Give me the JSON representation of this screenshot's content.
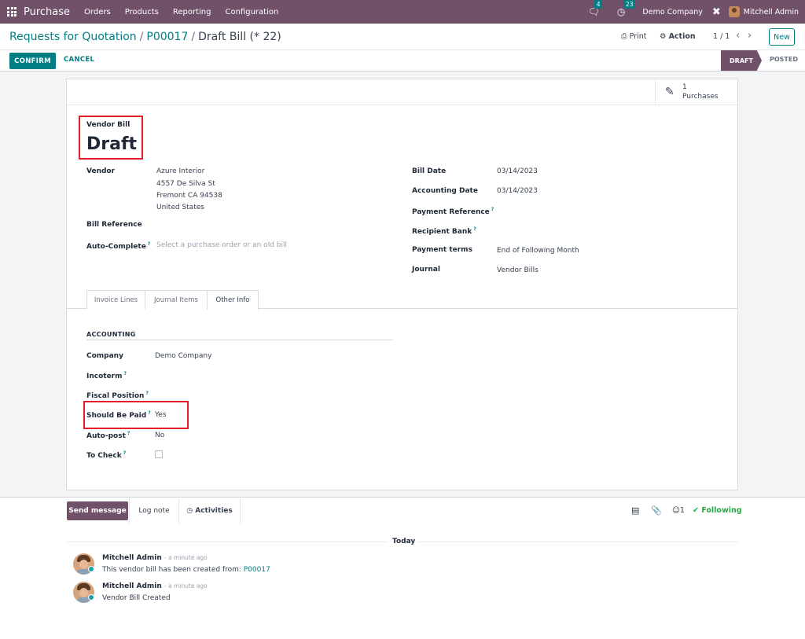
{
  "navbar": {
    "app_name": "Purchase",
    "menus": [
      "Orders",
      "Products",
      "Reporting",
      "Configuration"
    ],
    "messages_count": "4",
    "activities_count": "23",
    "company": "Demo Company",
    "user": "Mitchell Admin"
  },
  "control": {
    "breadcrumb": [
      "Requests for Quotation",
      "P00017",
      "Draft Bill (* 22)"
    ],
    "print_label": "Print",
    "action_label": "Action",
    "pager": "1 / 1",
    "new_label": "New"
  },
  "statusbar": {
    "confirm_label": "CONFIRM",
    "cancel_label": "CANCEL",
    "stages": [
      "DRAFT",
      "POSTED"
    ],
    "active_stage": "DRAFT"
  },
  "smart_button": {
    "count": "1",
    "label": "Purchases"
  },
  "form": {
    "type_label": "Vendor Bill",
    "title": "Draft",
    "left_fields": {
      "vendor_label": "Vendor",
      "vendor_lines": [
        "Azure Interior",
        "4557 De Silva St",
        "Fremont CA 94538",
        "United States"
      ],
      "bill_reference_label": "Bill Reference",
      "auto_complete_label": "Auto-Complete",
      "auto_complete_placeholder": "Select a purchase order or an old bill"
    },
    "right_fields": [
      {
        "label": "Bill Date",
        "value": "03/14/2023",
        "help": false
      },
      {
        "label": "Accounting Date",
        "value": "03/14/2023",
        "help": false
      },
      {
        "label": "Payment Reference",
        "value": "",
        "help": true
      },
      {
        "label": "Recipient Bank",
        "value": "",
        "help": true
      },
      {
        "label": "Payment terms",
        "value": "End of Following Month",
        "help": false
      },
      {
        "label": "Journal",
        "value": "Vendor Bills",
        "help": false
      }
    ],
    "tabs": [
      "Invoice Lines",
      "Journal Items",
      "Other Info"
    ],
    "active_tab": "Other Info",
    "section_title": "ACCOUNTING",
    "accounting_fields": [
      {
        "label": "Company",
        "value": "Demo Company",
        "help": false
      },
      {
        "label": "Incoterm",
        "value": "",
        "help": true
      },
      {
        "label": "Fiscal Position",
        "value": "",
        "help": true
      },
      {
        "label": "Should Be Paid",
        "value": "Yes",
        "help": true
      },
      {
        "label": "Auto-post",
        "value": "No",
        "help": true
      },
      {
        "label": "To Check",
        "value": "",
        "help": true
      }
    ],
    "help_mark": "?"
  },
  "chatter": {
    "send_message_label": "Send message",
    "log_note_label": "Log note",
    "activities_label": "Activities",
    "followers_count": "1",
    "following_label": "Following",
    "date_separator": "Today",
    "messages": [
      {
        "author": "Mitchell Admin",
        "time": "- a minute ago",
        "body": "This vendor bill has been created from: ",
        "link": "P00017"
      },
      {
        "author": "Mitchell Admin",
        "time": "- a minute ago",
        "body": "Vendor Bill Created",
        "link": ""
      }
    ]
  },
  "colors": {
    "brand": "#71506a",
    "accent": "#017e84",
    "highlight": "#e11d2a",
    "following": "#28a745"
  }
}
